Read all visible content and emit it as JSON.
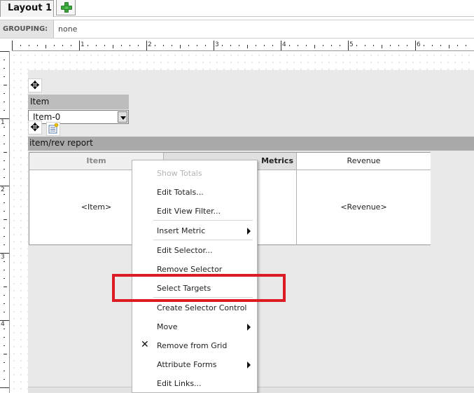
{
  "tabs": {
    "active_label": "Layout 1",
    "add_icon": "plus-icon"
  },
  "grouping": {
    "label": "GROUPING:",
    "value": "none"
  },
  "ruler": {
    "h_numbers": [
      "1",
      "2",
      "3",
      "4",
      "5",
      "6"
    ],
    "v_numbers": [
      "1",
      "2",
      "3",
      "4"
    ]
  },
  "item_selector": {
    "header": "Item",
    "selected": "Item-0"
  },
  "grid": {
    "title": "item/rev report",
    "headers": {
      "item": "Item",
      "metrics": "Metrics",
      "revenue": "Revenue"
    },
    "cells": {
      "item": "<Item>",
      "revenue": "<Revenue>"
    }
  },
  "context_menu": {
    "items": [
      {
        "label": "Show Totals",
        "disabled": true
      },
      {
        "label": "Edit Totals..."
      },
      {
        "label": "Edit View Filter..."
      },
      {
        "label": "Insert Metric",
        "submenu": true
      },
      {
        "label": "Edit Selector..."
      },
      {
        "label": "Remove Selector"
      },
      {
        "label": "Select Targets"
      },
      {
        "label": "Create Selector Control"
      },
      {
        "label": "Move",
        "submenu": true
      },
      {
        "label": "Remove from Grid",
        "icon": "x-icon"
      },
      {
        "label": "Attribute Forms",
        "submenu": true
      },
      {
        "label": "Edit Links..."
      }
    ]
  },
  "colors": {
    "highlight": "#dc1c22",
    "grid_title_bg": "#a9a9a9",
    "design_area_bg": "#e9e9e9"
  }
}
